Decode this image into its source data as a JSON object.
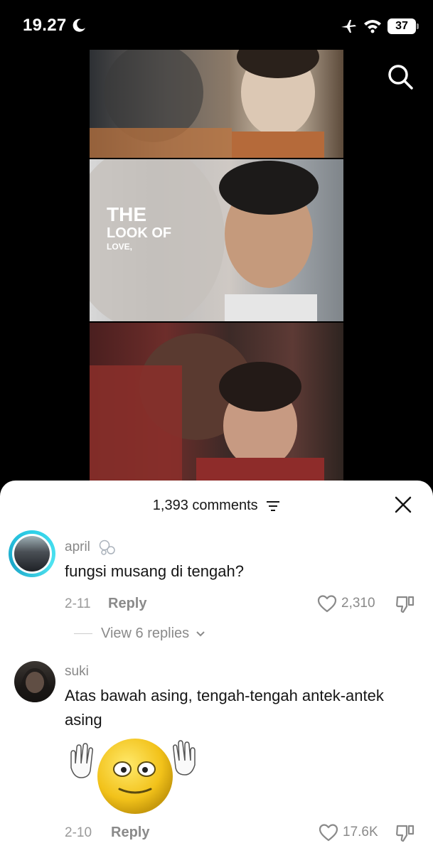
{
  "status_bar": {
    "time": "19.27",
    "battery": "37"
  },
  "video": {
    "headline": {
      "line1": "THE",
      "line2": "LOOK OF",
      "line3": "LOVE,"
    }
  },
  "comments_sheet": {
    "count_label": "1,393 comments",
    "comments": [
      {
        "username": "april",
        "text": "fungsi musang di tengah?",
        "date": "2-11",
        "reply_label": "Reply",
        "likes": "2,310",
        "view_replies": "View 6 replies"
      },
      {
        "username": "suki",
        "text": "Atas bawah asing, tengah-tengah antek-antek asing",
        "date": "2-10",
        "reply_label": "Reply",
        "likes": "17.6K"
      }
    ]
  }
}
